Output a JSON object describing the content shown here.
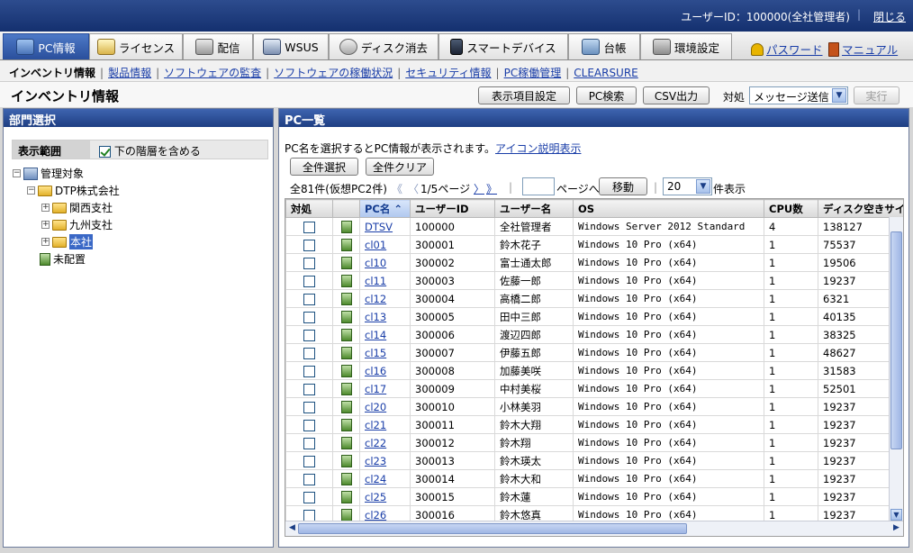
{
  "header": {
    "user_label": "ユーザーID：100000(全社管理者)",
    "logout": "閉じる"
  },
  "main_tabs": [
    {
      "label": "PC情報",
      "icon": "pc-icon"
    },
    {
      "label": "ライセンス",
      "icon": "license-icon"
    },
    {
      "label": "配信",
      "icon": "distribution-icon"
    },
    {
      "label": "WSUS",
      "icon": "wsus-icon"
    },
    {
      "label": "ディスク消去",
      "icon": "disk-erase-icon"
    },
    {
      "label": "スマートデバイス",
      "icon": "smart-device-icon"
    },
    {
      "label": "台帳",
      "icon": "ledger-icon"
    },
    {
      "label": "環境設定",
      "icon": "settings-icon"
    }
  ],
  "util_links": {
    "password": "パスワード",
    "manual": "マニュアル"
  },
  "sub_nav": {
    "current": "インベントリ情報",
    "links": [
      "製品情報",
      "ソフトウェアの監査",
      "ソフトウェアの稼働状況",
      "セキュリティ情報",
      "PC稼働管理",
      "CLEARSURE"
    ]
  },
  "page": {
    "title": "インベントリ情報",
    "btn_columns": "表示項目設定",
    "btn_search": "PC検索",
    "btn_csv": "CSV出力",
    "action_label": "対処",
    "action_value": "メッセージ送信",
    "btn_run": "実行"
  },
  "left_panel": {
    "title": "部門選択",
    "scope_label": "表示範囲",
    "include_sub": "下の階層を含める",
    "tree": {
      "root": "管理対象",
      "company": "DTP株式会社",
      "branches": [
        "関西支社",
        "九州支社",
        "本社"
      ],
      "unassigned": "未配置"
    }
  },
  "right_panel": {
    "title": "PC一覧",
    "info_text": "PC名を選択するとPC情報が表示されます。",
    "icon_link": "アイコン説明表示",
    "btn_select_all": "全件選択",
    "btn_clear_all": "全件クリア",
    "count_text": "全81件(仮想PC2件)",
    "page_text": "1/5ページ",
    "goto_suffix": "ページへ",
    "btn_move": "移動",
    "per_page": "20",
    "per_page_suffix": "件表示",
    "columns": [
      "対処",
      "",
      "PC名",
      "ユーザーID",
      "ユーザー名",
      "OS",
      "CPU数",
      "ディスク空きサイズ"
    ],
    "rows": [
      {
        "pc": "DTSV",
        "uid": "100000",
        "uname": "全社管理者",
        "os": "Windows Server 2012 Standard",
        "cpu": "4",
        "disk": "138127"
      },
      {
        "pc": "cl01",
        "uid": "300001",
        "uname": "鈴木花子",
        "os": "Windows 10 Pro (x64)",
        "cpu": "1",
        "disk": "75537"
      },
      {
        "pc": "cl10",
        "uid": "300002",
        "uname": "富士通太郎",
        "os": "Windows 10 Pro (x64)",
        "cpu": "1",
        "disk": "19506"
      },
      {
        "pc": "cl11",
        "uid": "300003",
        "uname": "佐藤一郎",
        "os": "Windows 10 Pro (x64)",
        "cpu": "1",
        "disk": "19237"
      },
      {
        "pc": "cl12",
        "uid": "300004",
        "uname": "高橋二郎",
        "os": "Windows 10 Pro (x64)",
        "cpu": "1",
        "disk": "6321"
      },
      {
        "pc": "cl13",
        "uid": "300005",
        "uname": "田中三郎",
        "os": "Windows 10 Pro (x64)",
        "cpu": "1",
        "disk": "40135"
      },
      {
        "pc": "cl14",
        "uid": "300006",
        "uname": "渡辺四郎",
        "os": "Windows 10 Pro (x64)",
        "cpu": "1",
        "disk": "38325"
      },
      {
        "pc": "cl15",
        "uid": "300007",
        "uname": "伊藤五郎",
        "os": "Windows 10 Pro (x64)",
        "cpu": "1",
        "disk": "48627"
      },
      {
        "pc": "cl16",
        "uid": "300008",
        "uname": "加藤美咲",
        "os": "Windows 10 Pro (x64)",
        "cpu": "1",
        "disk": "31583"
      },
      {
        "pc": "cl17",
        "uid": "300009",
        "uname": "中村美桜",
        "os": "Windows 10 Pro (x64)",
        "cpu": "1",
        "disk": "52501"
      },
      {
        "pc": "cl20",
        "uid": "300010",
        "uname": "小林美羽",
        "os": "Windows 10 Pro (x64)",
        "cpu": "1",
        "disk": "19237"
      },
      {
        "pc": "cl21",
        "uid": "300011",
        "uname": "鈴木大翔",
        "os": "Windows 10 Pro (x64)",
        "cpu": "1",
        "disk": "19237"
      },
      {
        "pc": "cl22",
        "uid": "300012",
        "uname": "鈴木翔",
        "os": "Windows 10 Pro (x64)",
        "cpu": "1",
        "disk": "19237"
      },
      {
        "pc": "cl23",
        "uid": "300013",
        "uname": "鈴木瑛太",
        "os": "Windows 10 Pro (x64)",
        "cpu": "1",
        "disk": "19237"
      },
      {
        "pc": "cl24",
        "uid": "300014",
        "uname": "鈴木大和",
        "os": "Windows 10 Pro (x64)",
        "cpu": "1",
        "disk": "19237"
      },
      {
        "pc": "cl25",
        "uid": "300015",
        "uname": "鈴木蓮",
        "os": "Windows 10 Pro (x64)",
        "cpu": "1",
        "disk": "19237"
      },
      {
        "pc": "cl26",
        "uid": "300016",
        "uname": "鈴木悠真",
        "os": "Windows 10 Pro (x64)",
        "cpu": "1",
        "disk": "19237"
      }
    ]
  },
  "colors": {
    "header": "#1e3e82",
    "active_tab": "#3e64b0",
    "link": "#1a3ea8"
  }
}
